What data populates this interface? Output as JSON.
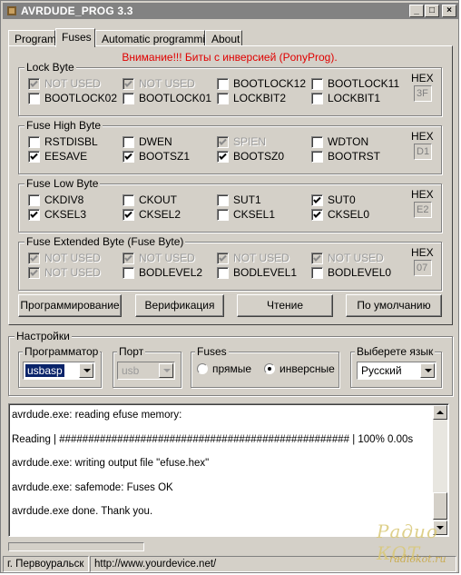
{
  "window": {
    "title": "AVRDUDE_PROG 3.3",
    "controls": {
      "minimize": "_",
      "maximize": "□",
      "close": "×"
    }
  },
  "tabs": [
    {
      "label": "Program",
      "active": false
    },
    {
      "label": "Fuses",
      "active": true
    },
    {
      "label": "Automatic programming",
      "active": false
    },
    {
      "label": "About",
      "active": false
    }
  ],
  "warning": "Внимание!!! Биты с инверсией (PonyProg).",
  "groups": {
    "lock": {
      "title": "Lock Byte",
      "hex_label": "HEX",
      "hex_value": "3F",
      "bits": [
        {
          "label": "NOT USED",
          "checked": true,
          "disabled": true
        },
        {
          "label": "NOT USED",
          "checked": true,
          "disabled": true
        },
        {
          "label": "BOOTLOCK12",
          "checked": false,
          "disabled": false
        },
        {
          "label": "BOOTLOCK11",
          "checked": false,
          "disabled": false
        },
        {
          "label": "BOOTLOCK02",
          "checked": false,
          "disabled": false
        },
        {
          "label": "BOOTLOCK01",
          "checked": false,
          "disabled": false
        },
        {
          "label": "LOCKBIT2",
          "checked": false,
          "disabled": false
        },
        {
          "label": "LOCKBIT1",
          "checked": false,
          "disabled": false
        }
      ]
    },
    "high": {
      "title": "Fuse High Byte",
      "hex_label": "HEX",
      "hex_value": "D1",
      "bits": [
        {
          "label": "RSTDISBL",
          "checked": false,
          "disabled": false
        },
        {
          "label": "DWEN",
          "checked": false,
          "disabled": false
        },
        {
          "label": "SPIEN",
          "checked": true,
          "disabled": true
        },
        {
          "label": "WDTON",
          "checked": false,
          "disabled": false
        },
        {
          "label": "EESAVE",
          "checked": true,
          "disabled": false
        },
        {
          "label": "BOOTSZ1",
          "checked": true,
          "disabled": false
        },
        {
          "label": "BOOTSZ0",
          "checked": true,
          "disabled": false
        },
        {
          "label": "BOOTRST",
          "checked": false,
          "disabled": false
        }
      ]
    },
    "low": {
      "title": "Fuse Low Byte",
      "hex_label": "HEX",
      "hex_value": "E2",
      "bits": [
        {
          "label": "CKDIV8",
          "checked": false,
          "disabled": false
        },
        {
          "label": "CKOUT",
          "checked": false,
          "disabled": false
        },
        {
          "label": "SUT1",
          "checked": false,
          "disabled": false
        },
        {
          "label": "SUT0",
          "checked": true,
          "disabled": false
        },
        {
          "label": "CKSEL3",
          "checked": true,
          "disabled": false
        },
        {
          "label": "CKSEL2",
          "checked": true,
          "disabled": false
        },
        {
          "label": "CKSEL1",
          "checked": false,
          "disabled": false
        },
        {
          "label": "CKSEL0",
          "checked": true,
          "disabled": false
        }
      ]
    },
    "ext": {
      "title": "Fuse Extended Byte (Fuse Byte)",
      "hex_label": "HEX",
      "hex_value": "07",
      "bits": [
        {
          "label": "NOT USED",
          "checked": true,
          "disabled": true
        },
        {
          "label": "NOT USED",
          "checked": true,
          "disabled": true
        },
        {
          "label": "NOT USED",
          "checked": true,
          "disabled": true
        },
        {
          "label": "NOT USED",
          "checked": true,
          "disabled": true
        },
        {
          "label": "NOT USED",
          "checked": true,
          "disabled": true
        },
        {
          "label": "BODLEVEL2",
          "checked": false,
          "disabled": false
        },
        {
          "label": "BODLEVEL1",
          "checked": false,
          "disabled": false
        },
        {
          "label": "BODLEVEL0",
          "checked": false,
          "disabled": false
        }
      ]
    }
  },
  "actions": {
    "program": "Программирование",
    "verify": "Верификация",
    "read": "Чтение",
    "default": "По умолчанию"
  },
  "settings": {
    "title": "Настройки",
    "programmer": {
      "label": "Программатор",
      "value": "usbasp"
    },
    "port": {
      "label": "Порт",
      "value": "usb"
    },
    "fuses": {
      "label": "Fuses",
      "direct": "прямые",
      "inverse": "инверсные",
      "selected": "inverse"
    },
    "language": {
      "label": "Выберете язык",
      "value": "Русский"
    }
  },
  "log": [
    "avrdude.exe: reading efuse memory:",
    "",
    "Reading | ################################################## | 100% 0.00s",
    "",
    "avrdude.exe: writing output file \"efuse.hex\"",
    "",
    "avrdude.exe: safemode: Fuses OK",
    "",
    "avrdude.exe done.  Thank you."
  ],
  "status": {
    "city": "г. Первоуральск",
    "url": "http://www.yourdevice.net/"
  },
  "watermark": {
    "line1": "Радио КОТ",
    "line2": "radiokot.ru"
  }
}
